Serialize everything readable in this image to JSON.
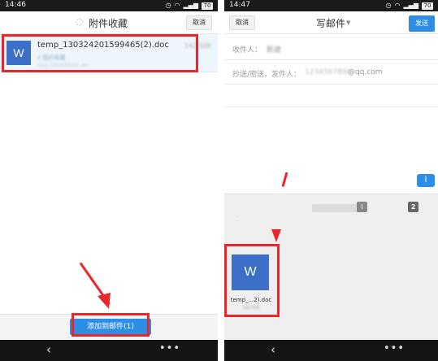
{
  "left": {
    "status": {
      "time": "14:46",
      "battery": "70"
    },
    "title": "附件收藏",
    "cancel_label": "取消",
    "file": {
      "icon_letter": "W",
      "name": "temp_1303242015994... (2).doc",
      "name_visible": "temp_130324201599465(2).doc",
      "size": "142.50K",
      "subtitle": "x 我的收藏",
      "meta": "temp_13032420159 .doc"
    },
    "add_button_label": "添加到邮件(1)",
    "nav": {
      "back": "‹",
      "menu": "•••"
    }
  },
  "right": {
    "status": {
      "time": "14:47",
      "battery": "70"
    },
    "cancel_label": "取消",
    "title": "写邮件",
    "send_label": "发送",
    "to_label": "收件人：",
    "to_value": "新建",
    "cc_label": "抄送/密送，发件人：",
    "from_value": "@qq.com",
    "from_blurred": "1234567890",
    "attach_panel_number": "2",
    "attachment": {
      "icon_letter": "W",
      "name": "temp_...2).doc",
      "size": "142.50K"
    },
    "nav": {
      "back": "‹",
      "menu": "•••"
    }
  }
}
